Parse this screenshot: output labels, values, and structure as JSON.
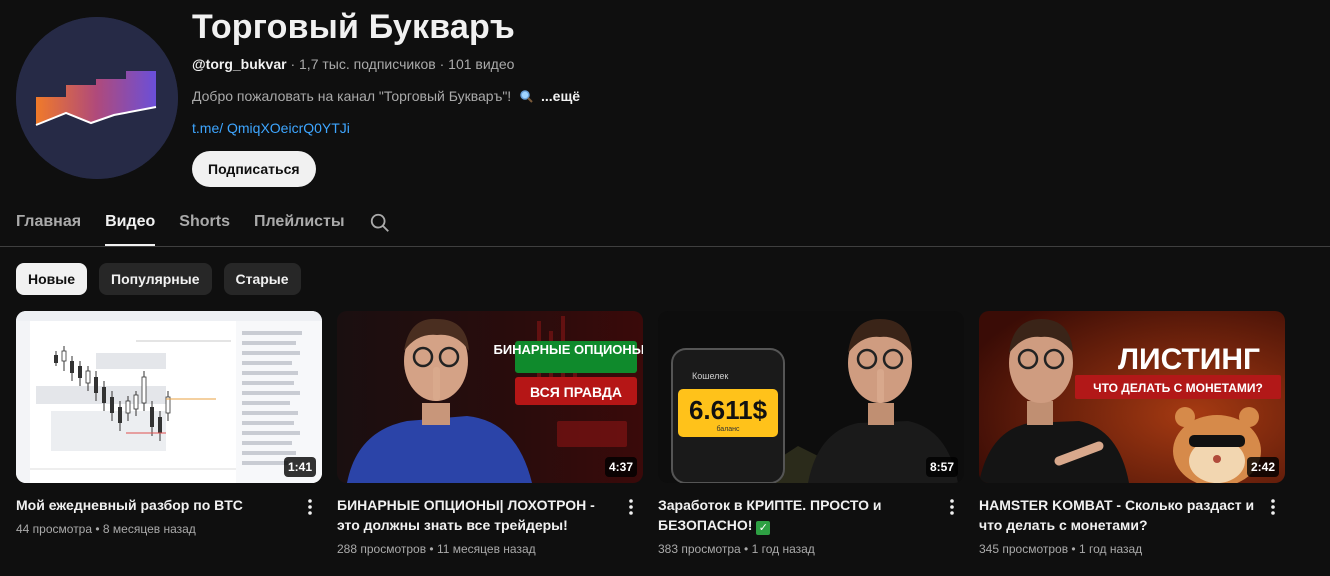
{
  "channel": {
    "title": "Торговый Букваръ",
    "handle": "@torg_bukvar",
    "subscribers": "1,7 тыс. подписчиков",
    "video_count": "101 видео",
    "description": "Добро пожаловать на канал \"Торговый Букваръ\"!",
    "more": "...ещё",
    "link": "t.me/ QmiqXOeicrQ0YTJi",
    "subscribe_label": "Подписаться"
  },
  "tabs": [
    {
      "label": "Главная"
    },
    {
      "label": "Видео",
      "active": true
    },
    {
      "label": "Shorts"
    },
    {
      "label": "Плейлисты"
    }
  ],
  "chips": [
    {
      "label": "Новые",
      "active": true
    },
    {
      "label": "Популярные"
    },
    {
      "label": "Старые"
    }
  ],
  "videos": [
    {
      "title": "Мой ежедневный разбор по BTC",
      "duration": "1:41",
      "views": "44 просмотра",
      "age": "8 месяцев назад"
    },
    {
      "title": "БИНАРНЫЕ ОПЦИОНЫ| ЛОХОТРОН - это должны знать все трейдеры!",
      "duration": "4:37",
      "views": "288 просмотров",
      "age": "11 месяцев назад",
      "thumb_text_1": "БИНАРНЫЕ ОПЦИОНЫ",
      "thumb_text_2": "ВСЯ ПРАВДА"
    },
    {
      "title": "Заработок в КРИПТЕ. ПРОСТО и БЕЗОПАСНО!",
      "duration": "8:57",
      "views": "383 просмотра",
      "age": "1 год назад",
      "thumb_wallet": "Кошелек",
      "thumb_amount": "6.611$",
      "thumb_balance": "баланс"
    },
    {
      "title": "HAMSTER KOMBAT - Сколько раздаст и что делать с монетами?",
      "duration": "2:42",
      "views": "345 просмотров",
      "age": "1 год назад",
      "thumb_text_1": "ЛИСТИНГ",
      "thumb_text_2": "ЧТО ДЕЛАТЬ С МОНЕТАМИ?"
    }
  ],
  "colors": {
    "accent_link": "#3ea6ff",
    "background": "#0f0f0f"
  }
}
